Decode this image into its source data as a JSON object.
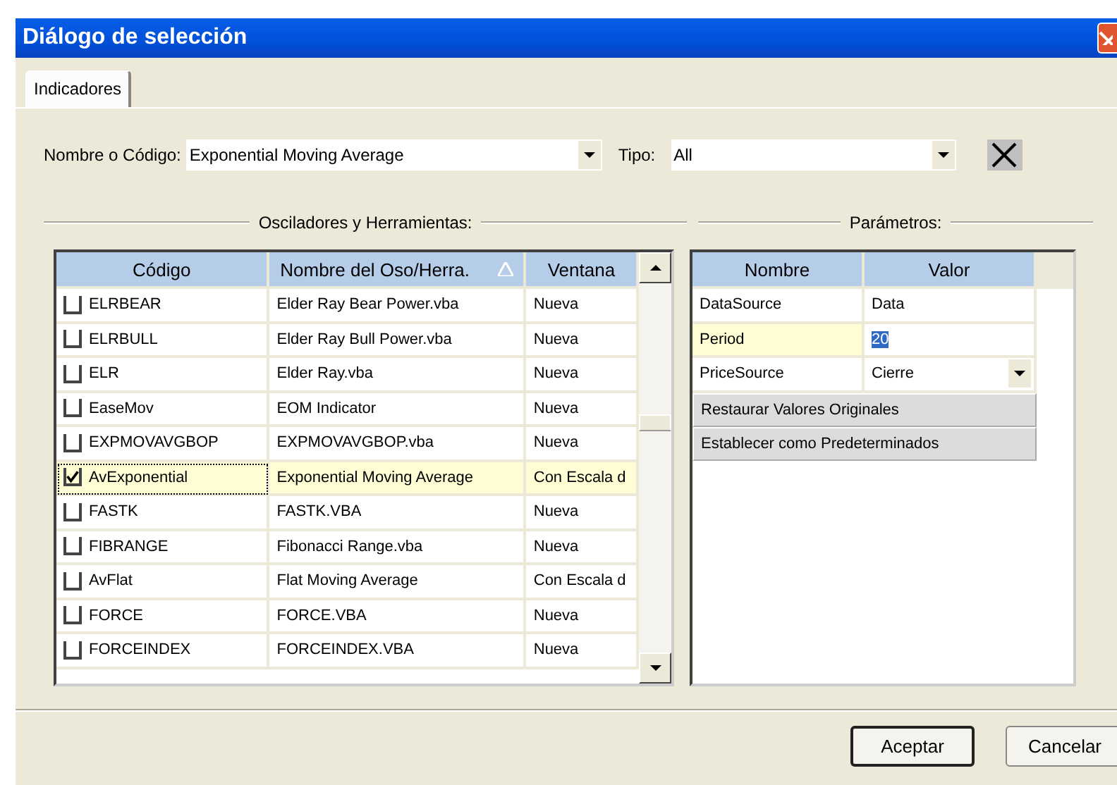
{
  "window": {
    "title": "Diálogo de selección"
  },
  "tabs": [
    {
      "label": "Indicadores",
      "selected": true
    }
  ],
  "name_field": {
    "label": "Nombre o Código:",
    "value": "Exponential Moving Average"
  },
  "type_field": {
    "label": "Tipo:",
    "value": "All"
  },
  "sections": {
    "left": "Osciladores y Herramientas:",
    "right": "Parámetros:"
  },
  "table": {
    "columns": [
      "Código",
      "Nombre del Oso/Herra.",
      "Ventana"
    ],
    "rows": [
      {
        "checked": false,
        "selected": false,
        "cells": [
          "ELRBEAR",
          "Elder Ray Bear Power.vba",
          "Nueva"
        ]
      },
      {
        "checked": false,
        "selected": false,
        "cells": [
          "ELRBULL",
          "Elder Ray Bull Power.vba",
          "Nueva"
        ]
      },
      {
        "checked": false,
        "selected": false,
        "cells": [
          "ELR",
          "Elder Ray.vba",
          "Nueva"
        ]
      },
      {
        "checked": false,
        "selected": false,
        "cells": [
          "EaseMov",
          "EOM Indicator",
          "Nueva"
        ]
      },
      {
        "checked": false,
        "selected": false,
        "cells": [
          "EXPMOVAVGBOP",
          "EXPMOVAVGBOP.vba",
          "Nueva"
        ]
      },
      {
        "checked": true,
        "selected": true,
        "cells": [
          "AvExponential",
          "Exponential Moving Average",
          "Con Escala d"
        ]
      },
      {
        "checked": false,
        "selected": false,
        "cells": [
          "FASTK",
          "FASTK.VBA",
          "Nueva"
        ]
      },
      {
        "checked": false,
        "selected": false,
        "cells": [
          "FIBRANGE",
          "Fibonacci Range.vba",
          "Nueva"
        ]
      },
      {
        "checked": false,
        "selected": false,
        "cells": [
          "AvFlat",
          "Flat Moving Average",
          "Con Escala d"
        ]
      },
      {
        "checked": false,
        "selected": false,
        "cells": [
          "FORCE",
          "FORCE.VBA",
          "Nueva"
        ]
      },
      {
        "checked": false,
        "selected": false,
        "cells": [
          "FORCEINDEX",
          "FORCEINDEX.VBA",
          "Nueva"
        ]
      }
    ]
  },
  "parameters": {
    "columns": [
      "Nombre",
      "Valor"
    ],
    "rows": [
      {
        "kind": "text",
        "selected": false,
        "name": "DataSource",
        "value": "Data"
      },
      {
        "kind": "edit",
        "selected": true,
        "name": "Period",
        "value": "20"
      },
      {
        "kind": "dropdown",
        "selected": false,
        "name": "PriceSource",
        "value": "Cierre"
      }
    ],
    "actions": [
      "Restaurar Valores Originales",
      "Establecer como Predeterminados"
    ]
  },
  "buttons": [
    "Aceptar",
    "Cancelar"
  ]
}
